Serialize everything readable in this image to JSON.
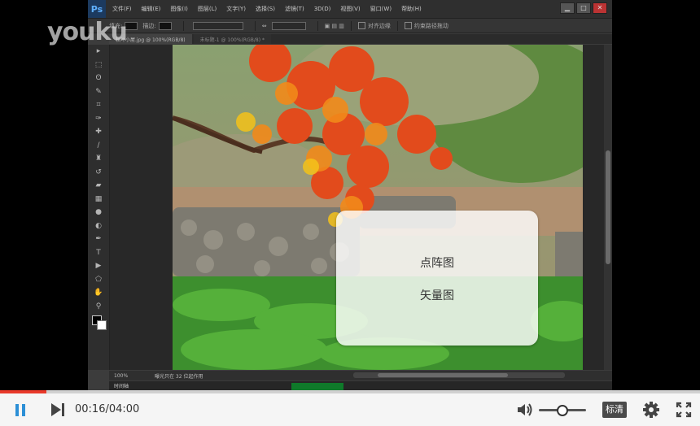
{
  "watermark": "youku",
  "photoshop": {
    "logo": "Ps",
    "menu": [
      "文件(F)",
      "编辑(E)",
      "图像(I)",
      "图层(L)",
      "文字(Y)",
      "选择(S)",
      "滤镜(T)",
      "3D(D)",
      "视图(V)",
      "窗口(W)",
      "帮助(H)"
    ],
    "options": {
      "fill_label": "填充:",
      "stroke_label": "描边:",
      "align_edges": "对齐边缘",
      "constrain_path": "约束路径拖动"
    },
    "tabs": [
      "秋叶小屋.jpg @ 100%(RGB/8)",
      "未标题-1 @ 100%(RGB/8) *"
    ],
    "status": {
      "zoom": "100%",
      "info": "曝光只在 32 位起作用"
    },
    "timeline_label": "时间轴"
  },
  "overlay_card": {
    "items": [
      "点阵图",
      "矢量图"
    ]
  },
  "player": {
    "current_time": "00:16",
    "total_time": "04:00",
    "time_display": "00:16/04:00",
    "progress": 0.0667,
    "volume": 0.5,
    "quality_label": "标清",
    "accent_color": "#2c8fd6",
    "progress_color": "#e8392a"
  }
}
